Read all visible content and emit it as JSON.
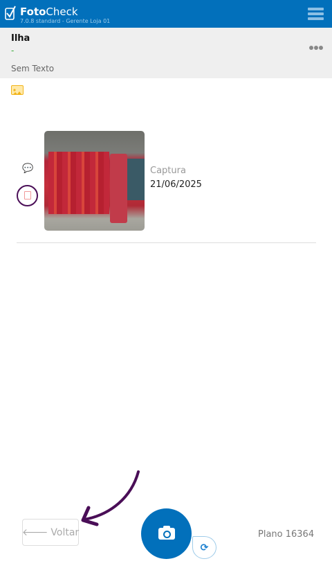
{
  "app": {
    "brand_bold": "Foto",
    "brand_light": "Check",
    "version": "7.0.8 standard - Gerente Loja 01"
  },
  "header": {
    "title": "Ilha",
    "subtitle": "-",
    "text": "Sem Texto"
  },
  "photo_item": {
    "label": "Captura",
    "date": "21/06/2025"
  },
  "footer": {
    "back_label": "Voltar",
    "plan": "Plano 16364"
  },
  "colors": {
    "primary": "#0270bb",
    "annotation": "#4a0e57"
  }
}
